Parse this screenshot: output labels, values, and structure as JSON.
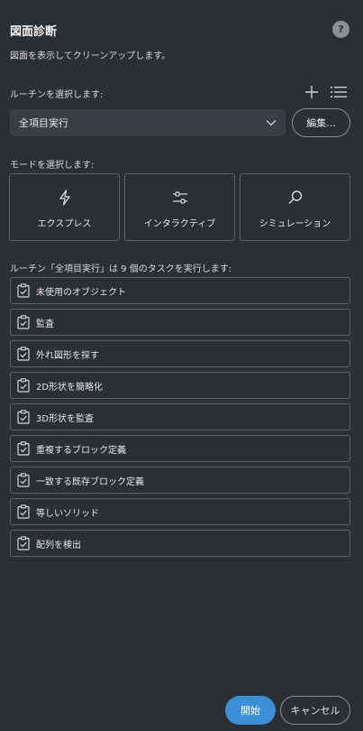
{
  "header": {
    "title": "図面診断",
    "help_label": "?",
    "subtitle": "図面を表示してクリーンアップします。"
  },
  "routine": {
    "label": "ルーチンを選択します:",
    "selected": "全項目実行",
    "edit_label": "編集..."
  },
  "mode": {
    "label": "モードを選択します:",
    "options": [
      {
        "label": "エクスプレス",
        "icon": "lightning-icon"
      },
      {
        "label": "インタラクティブ",
        "icon": "sliders-icon"
      },
      {
        "label": "シミュレーション",
        "icon": "magnifier-icon"
      }
    ]
  },
  "tasks": {
    "label": "ルーチン「全項目実行」は 9 個のタスクを実行します:",
    "items": [
      "未使用のオブジェクト",
      "監査",
      "外れ図形を探す",
      "2D形状を簡略化",
      "3D形状を監査",
      "重複するブロック定義",
      "一致する既存ブロック定義",
      "等しいソリッド",
      "配列を検出"
    ]
  },
  "footer": {
    "start_label": "開始",
    "cancel_label": "キャンセル"
  },
  "colors": {
    "background": "#2b2e33",
    "accent": "#3b8fd6",
    "border": "#5c6067"
  }
}
